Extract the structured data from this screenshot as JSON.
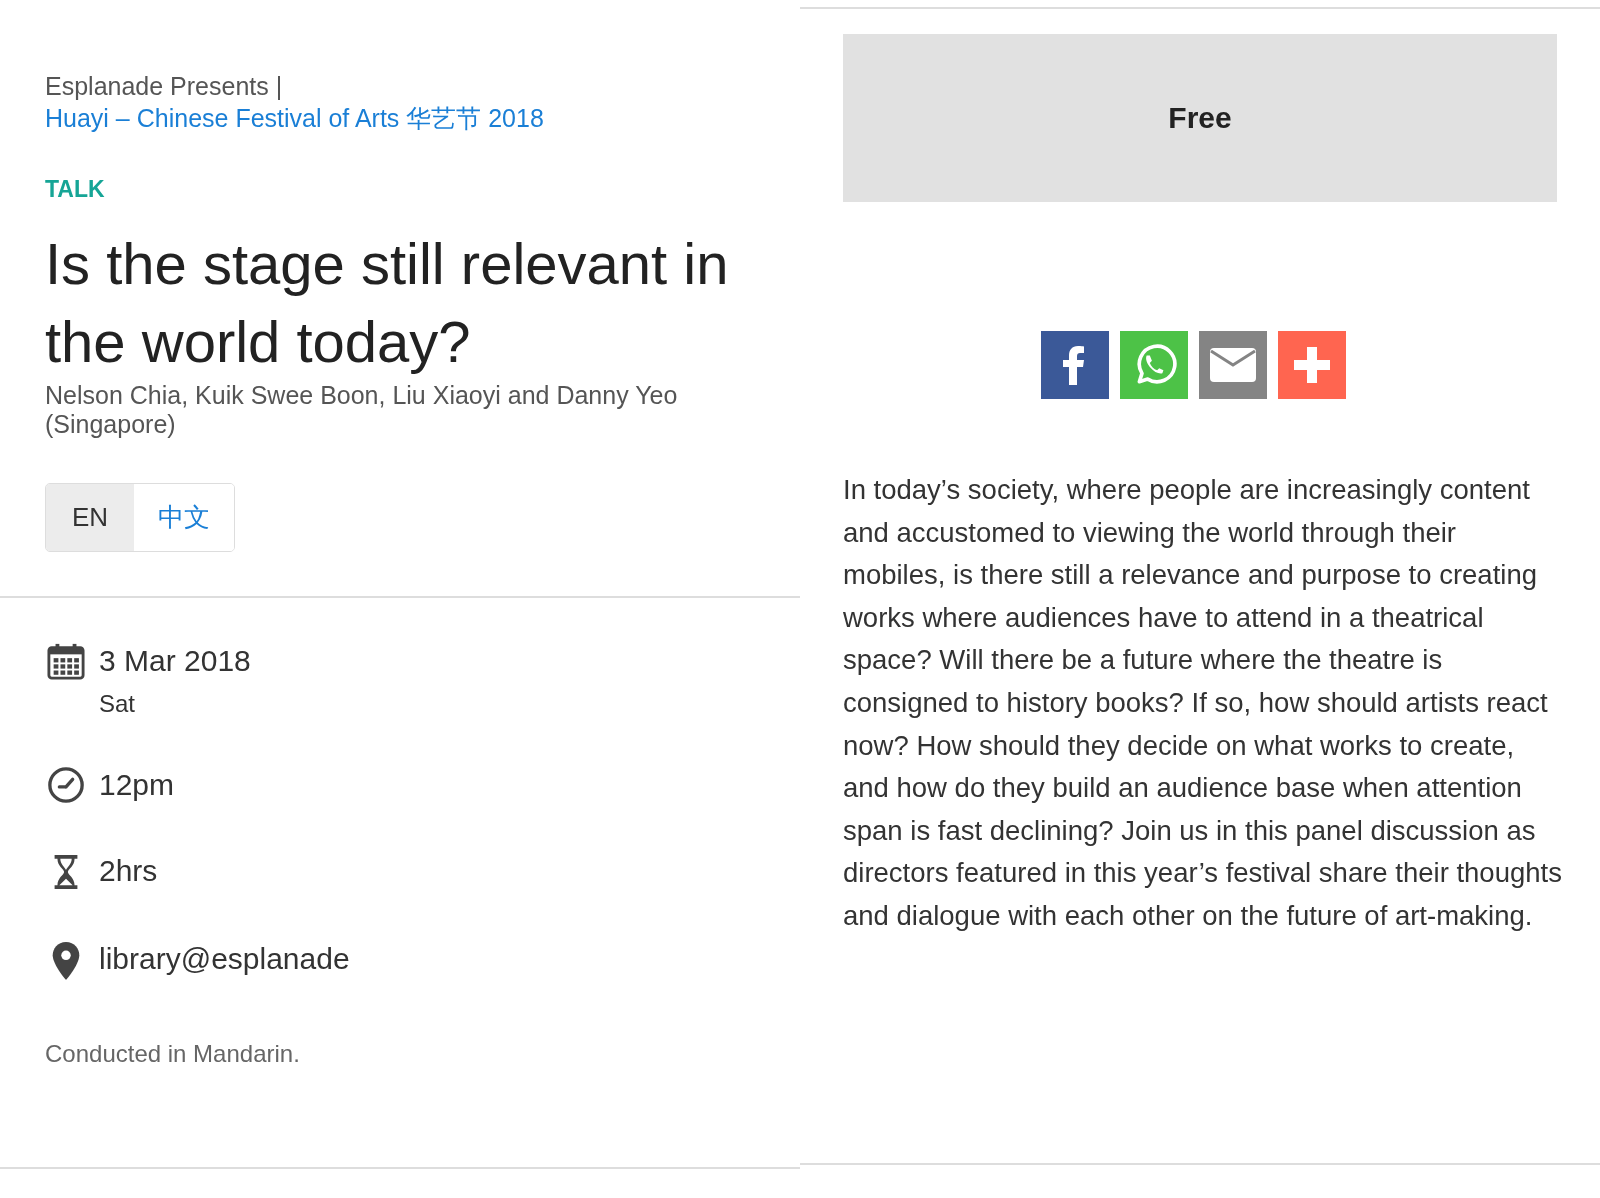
{
  "breadcrumb": {
    "presenter": "Esplanade Presents",
    "separator": "|",
    "festival": "Huayi – Chinese Festival of Arts 华艺节 2018"
  },
  "category": "TALK",
  "title": "Is the stage still relevant in the world today?",
  "artists": "Nelson Chia, Kuik Swee Boon, Liu Xiaoyi and Danny Yeo (Singapore)",
  "languages": [
    {
      "label": "EN",
      "selected": true
    },
    {
      "label": "中文",
      "selected": false
    }
  ],
  "details": [
    {
      "kind": "date",
      "text": "3 Mar 2018",
      "subtext": "Sat"
    },
    {
      "kind": "time",
      "text": "12pm"
    },
    {
      "kind": "duration",
      "text": "2hrs"
    },
    {
      "kind": "venue",
      "text": "library@esplanade"
    }
  ],
  "note": "Conducted in Mandarin.",
  "price": "Free",
  "share": [
    {
      "kind": "facebook"
    },
    {
      "kind": "whatsapp"
    },
    {
      "kind": "email"
    },
    {
      "kind": "more"
    }
  ],
  "description": "In today’s society, where people are increasingly content and accustomed to viewing the world through their mobiles, is there still a relevance and purpose to creating works where audiences have to attend in a theatrical space? Will there be a future where the theatre is consigned to history books? If so, how should artists react now? How should they decide on what works to create, and how do they build an audience base when attention span is fast declining? Join us in this panel discussion as directors featured in this year’s festival share their thoughts and dialogue with each other on the future of art-making."
}
